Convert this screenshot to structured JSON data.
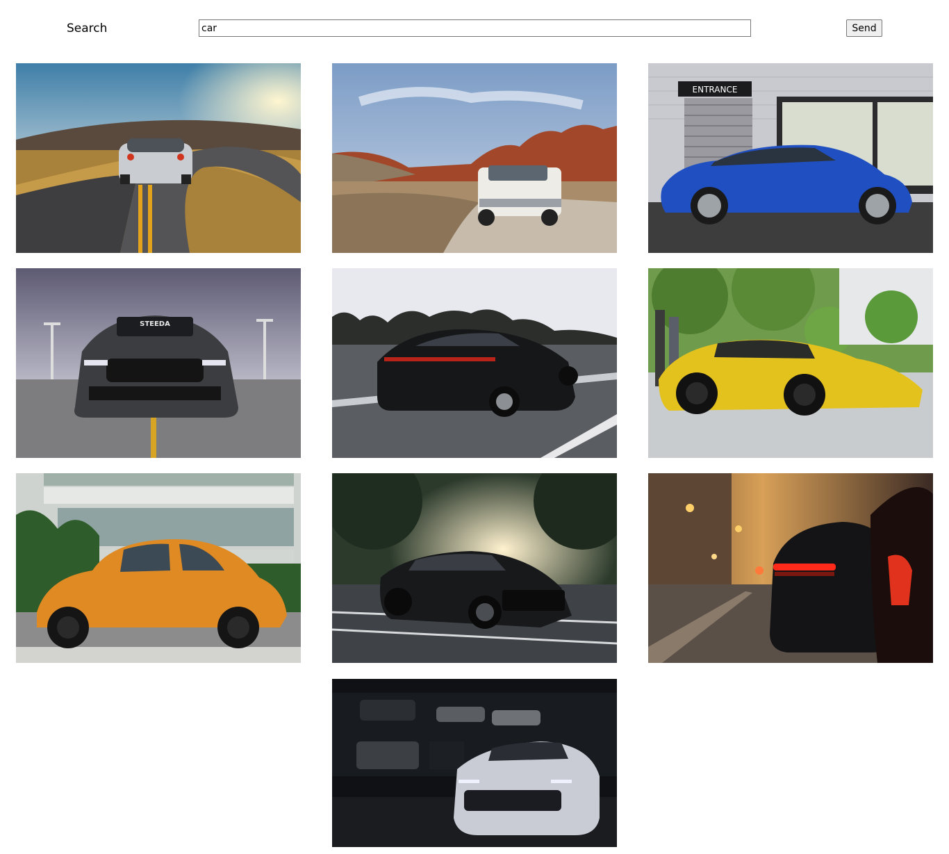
{
  "search": {
    "label": "Search",
    "value": "car",
    "placeholder": ""
  },
  "send_button": {
    "label": "Send"
  },
  "images": [
    {
      "subject": "silver sports car on winding road at sunset"
    },
    {
      "subject": "white SUV on desert dirt road near red rocks"
    },
    {
      "subject": "blue coupe parked by building entrance",
      "sign_text": "ENTRANCE"
    },
    {
      "subject": "dark grey muscle car front view on parking deck",
      "windshield_text": "STEEDA"
    },
    {
      "subject": "black sedan driving on highway"
    },
    {
      "subject": "yellow supercar parked on street"
    },
    {
      "subject": "orange vintage beetle parked by building"
    },
    {
      "subject": "black muscle car in parking lot under trees"
    },
    {
      "subject": "dark sports car rear lights on city street at dusk"
    },
    {
      "subject": "white sports car in dark garage"
    }
  ]
}
